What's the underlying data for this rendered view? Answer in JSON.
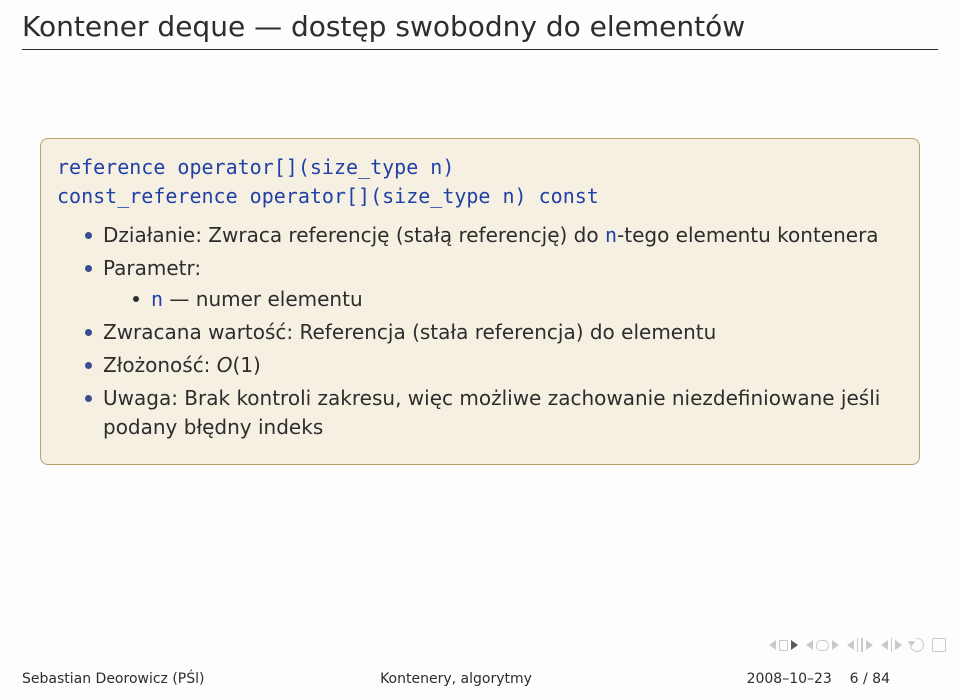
{
  "title": "Kontener deque — dostęp swobodny do elementów",
  "code": {
    "line1": "reference operator[](size_type n)",
    "line2": "const_reference operator[](size_type n) const"
  },
  "bullets": {
    "dzialanie_pre": "Działanie: Zwraca referencję (stałą referencję) do ",
    "dzialanie_n": "n",
    "dzialanie_post": "-tego elementu kontenera",
    "parametr": "Parametr:",
    "param_n_name": "n",
    "param_n_desc": " — numer elementu",
    "zwracana": "Zwracana wartość: Referencja (stała referencja) do elementu",
    "zlozonosc_label": "Złożoność: ",
    "zlozonosc_o": "O",
    "zlozonosc_arg": "(1)",
    "uwaga": "Uwaga: Brak kontroli zakresu, więc możliwe zachowanie niezdefiniowane jeśli podany błędny indeks"
  },
  "footer": {
    "left": "Sebastian Deorowicz (PŚl)",
    "center": "Kontenery, algorytmy",
    "date": "2008–10–23",
    "page": "6 / 84"
  }
}
